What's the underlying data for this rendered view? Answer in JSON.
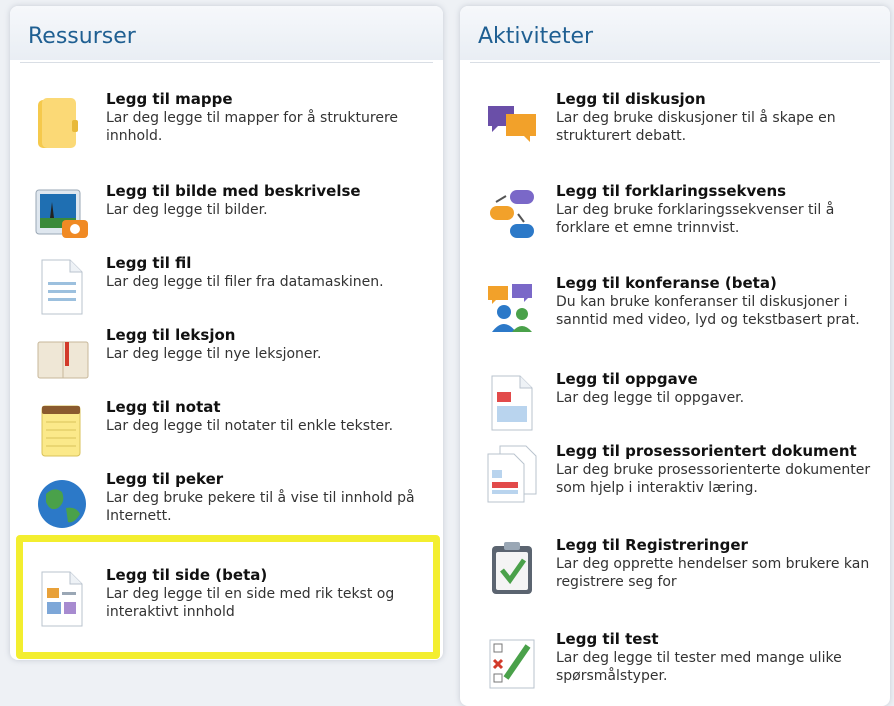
{
  "resources": {
    "title": "Ressurser",
    "items": [
      {
        "title": "Legg til mappe",
        "desc": "Lar deg legge til mapper for å strukturere innhold.",
        "icon": "folder-icon"
      },
      {
        "title": "Legg til bilde med beskrivelse",
        "desc": "Lar deg legge til bilder.",
        "icon": "image-icon"
      },
      {
        "title": "Legg til fil",
        "desc": "Lar deg legge til filer fra datamaskinen.",
        "icon": "file-icon"
      },
      {
        "title": "Legg til leksjon",
        "desc": "Lar deg legge til nye leksjoner.",
        "icon": "book-icon"
      },
      {
        "title": "Legg til notat",
        "desc": "Lar deg legge til notater til enkle tekster.",
        "icon": "notepad-icon"
      },
      {
        "title": "Legg til peker",
        "desc": "Lar deg bruke pekere til å vise til innhold på Internett.",
        "icon": "globe-icon"
      },
      {
        "title": "Legg til side (beta)",
        "desc": "Lar deg legge til en side med rik tekst og interaktivt innhold",
        "icon": "page-icon"
      }
    ]
  },
  "activities": {
    "title": "Aktiviteter",
    "items": [
      {
        "title": "Legg til diskusjon",
        "desc": "Lar deg bruke diskusjoner til å skape en strukturert debatt.",
        "icon": "discussion-icon"
      },
      {
        "title": "Legg til forklaringssekvens",
        "desc": "Lar deg bruke forklaringssekvenser til å forklare et emne trinnvist.",
        "icon": "sequence-icon"
      },
      {
        "title": "Legg til konferanse (beta)",
        "desc": "Du kan bruke konferanser til diskusjoner i sanntid med video, lyd og tekstbasert prat.",
        "icon": "conference-icon"
      },
      {
        "title": "Legg til oppgave",
        "desc": "Lar deg legge til oppgaver.",
        "icon": "assignment-icon"
      },
      {
        "title": "Legg til prosessorientert dokument",
        "desc": "Lar deg bruke prosessorienterte dokumenter som hjelp i interaktiv læring.",
        "icon": "documents-icon"
      },
      {
        "title": "Legg til Registreringer",
        "desc": "Lar deg opprette hendelser som brukere kan registrere seg for",
        "icon": "clipboard-check-icon"
      },
      {
        "title": "Legg til test",
        "desc": "Lar deg legge til tester med mange ulike spørsmålstyper.",
        "icon": "test-icon"
      }
    ]
  },
  "colors": {
    "title": "#1f5f92",
    "highlight": "#f3ee2f"
  }
}
